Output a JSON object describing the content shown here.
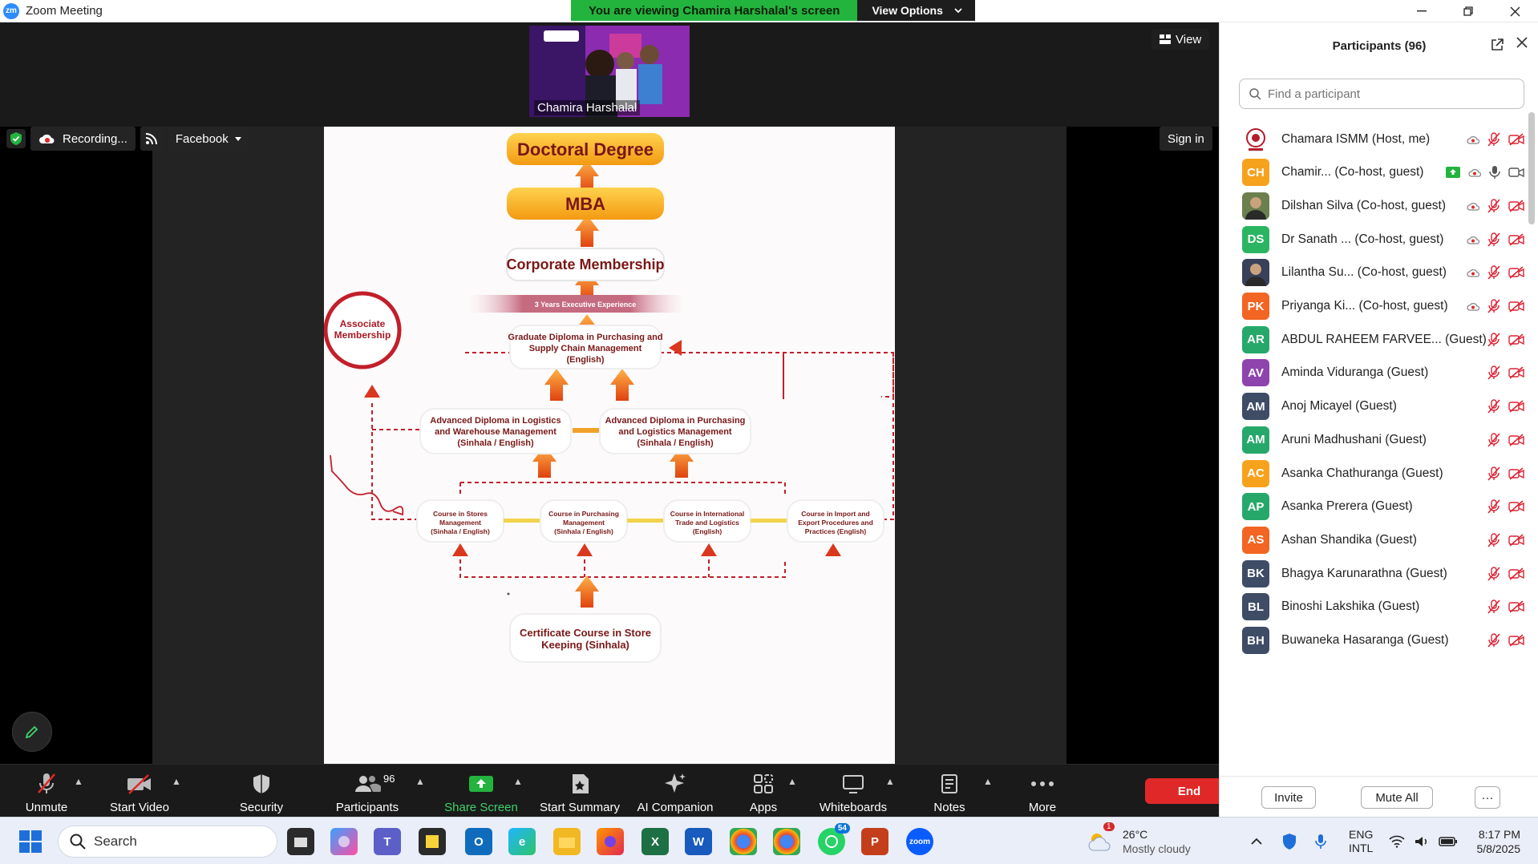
{
  "titlebar": {
    "title": "Zoom Meeting",
    "banner_message": "You are viewing Chamira Harshalal's screen",
    "view_options": "View Options"
  },
  "meeting": {
    "presenter_name": "Chamira Harshalal",
    "view_label": "View",
    "recording_label": "Recording...",
    "stream_label": "Facebook",
    "sign_in": "Sign in"
  },
  "document": {
    "doctoral": "Doctoral Degree",
    "mba": "MBA",
    "corporate": "Corporate Membership",
    "experience": "3 Years Executive Experience",
    "associate_1": "Associate",
    "associate_2": "Membership",
    "graduate_1": "Graduate Diploma in Purchasing and",
    "graduate_2": "Supply Chain Management",
    "graduate_3": "(English)",
    "adv_left_1": "Advanced Diploma in Logistics",
    "adv_left_2": "and Warehouse Management",
    "adv_left_3": "(Sinhala / English)",
    "adv_right_1": "Advanced Diploma in Purchasing",
    "adv_right_2": "and Logistics Management",
    "adv_right_3": "(Sinhala / English)",
    "course1": [
      "Course in Stores",
      "Management",
      "(Sinhala / English)"
    ],
    "course2": [
      "Course in Purchasing",
      "Management",
      "(Sinhala / English)"
    ],
    "course3": [
      "Course in International",
      "Trade and Logistics",
      "(English)"
    ],
    "course4": [
      "Course in Import and",
      "Export Procedures and",
      "Practices (English)"
    ],
    "certificate_1": "Certificate Course in Store",
    "certificate_2": "Keeping (Sinhala)"
  },
  "toolbar": {
    "unmute": "Unmute",
    "start_video": "Start Video",
    "security": "Security",
    "participants": "Participants",
    "participants_count": "96",
    "share_screen": "Share Screen",
    "start_summary": "Start Summary",
    "ai_companion": "AI Companion",
    "apps": "Apps",
    "whiteboards": "Whiteboards",
    "notes": "Notes",
    "more": "More",
    "end": "End"
  },
  "panel": {
    "title": "Participants (96)",
    "search_placeholder": "Find a participant",
    "invite": "Invite",
    "mute_all": "Mute All",
    "more": "···",
    "participants": [
      {
        "initials": "",
        "name": "Chamara ISMM (Host, me)",
        "color": "#ffffff",
        "photo": "logo"
      },
      {
        "initials": "CH",
        "name": "Chamir... (Co-host, guest)",
        "color": "#f6a21d"
      },
      {
        "initials": "",
        "name": "Dilshan Silva (Co-host, guest)",
        "color": "#6b7f4f",
        "photo": "person"
      },
      {
        "initials": "DS",
        "name": "Dr Sanath ...  (Co-host, guest)",
        "color": "#2bb563"
      },
      {
        "initials": "",
        "name": "Lilantha Su...  (Co-host, guest)",
        "color": "#39405a",
        "photo": "person"
      },
      {
        "initials": "PK",
        "name": "Priyanga Ki...  (Co-host, guest)",
        "color": "#f26522"
      },
      {
        "initials": "AR",
        "name": "ABDUL RAHEEM FARVEE... (Guest)",
        "color": "#26a86a"
      },
      {
        "initials": "AV",
        "name": "Aminda Viduranga (Guest)",
        "color": "#8e44ad"
      },
      {
        "initials": "AM",
        "name": "Anoj Micayel (Guest)",
        "color": "#3e4c66"
      },
      {
        "initials": "AM",
        "name": "Aruni Madhushani (Guest)",
        "color": "#26a86a"
      },
      {
        "initials": "AC",
        "name": "Asanka Chathuranga (Guest)",
        "color": "#f6a21d"
      },
      {
        "initials": "AP",
        "name": "Asanka Prerera (Guest)",
        "color": "#26a86a"
      },
      {
        "initials": "AS",
        "name": "Ashan Shandika (Guest)",
        "color": "#f26522"
      },
      {
        "initials": "BK",
        "name": "Bhagya Karunarathna (Guest)",
        "color": "#3e4c66"
      },
      {
        "initials": "BL",
        "name": "Binoshi Lakshika (Guest)",
        "color": "#3e4c66"
      },
      {
        "initials": "BH",
        "name": "Buwaneka Hasaranga (Guest)",
        "color": "#3e4c66"
      }
    ]
  },
  "taskbar": {
    "search": "Search",
    "weather_temp": "26°C",
    "weather_desc": "Mostly cloudy",
    "weather_badge": "1",
    "lang_1": "ENG",
    "lang_2": "INTL",
    "time": "8:17 PM",
    "date": "5/8/2025",
    "whatsapp_badge": "54"
  }
}
